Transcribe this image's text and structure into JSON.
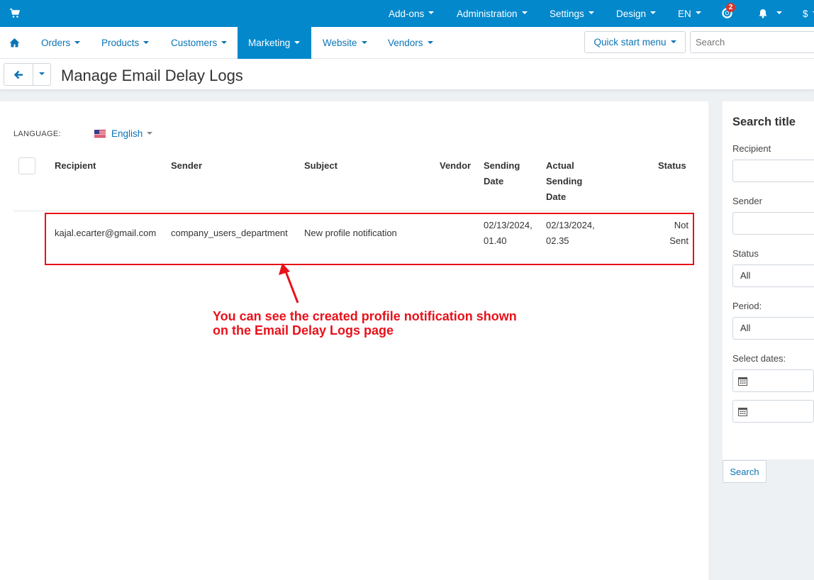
{
  "topbar": {
    "items": [
      {
        "label": "Add-ons"
      },
      {
        "label": "Administration"
      },
      {
        "label": "Settings"
      },
      {
        "label": "Design"
      },
      {
        "label": "EN"
      }
    ],
    "help_badge": "2",
    "currency": "$",
    "icons": [
      "cart-icon",
      "lifebuoy-icon",
      "bell-icon"
    ],
    "color": "#0388cc"
  },
  "nav": {
    "items": [
      {
        "label": "Orders"
      },
      {
        "label": "Products"
      },
      {
        "label": "Customers"
      },
      {
        "label": "Marketing",
        "active": true
      },
      {
        "label": "Website"
      },
      {
        "label": "Vendors"
      }
    ],
    "quick_start": "Quick start menu",
    "search_placeholder": "Search"
  },
  "page": {
    "title": "Manage Email Delay Logs"
  },
  "language": {
    "label": "LANGUAGE:",
    "value": "English"
  },
  "table": {
    "headers": {
      "recipient": "Recipient",
      "sender": "Sender",
      "subject": "Subject",
      "vendor": "Vendor",
      "sending_date_1": "Sending",
      "sending_date_2": "Date",
      "actual_1": "Actual",
      "actual_2": "Sending",
      "actual_3": "Date",
      "status": "Status"
    },
    "rows": [
      {
        "recipient": "kajal.ecarter@gmail.com",
        "sender": "company_users_department",
        "subject": "New profile notification",
        "vendor": "",
        "sending_date_1": "02/13/2024,",
        "sending_date_2": "01.40",
        "actual_1": "02/13/2024,",
        "actual_2": "02.35",
        "status_1": "Not",
        "status_2": "Sent"
      }
    ]
  },
  "annotation": {
    "line1": "You can see the created profile notification shown",
    "line2": "on the Email Delay Logs page",
    "color": "#e8111a"
  },
  "panel": {
    "title": "Search title",
    "recipient_label": "Recipient",
    "sender_label": "Sender",
    "status_label": "Status",
    "status_value": "All",
    "period_label": "Period:",
    "period_value": "All",
    "dates_label": "Select dates:",
    "search_button": "Search"
  }
}
